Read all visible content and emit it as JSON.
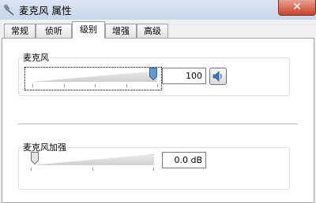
{
  "window": {
    "title": "麦克风 属性",
    "close_label": "✕"
  },
  "tabs": [
    "常规",
    "侦听",
    "级别",
    "增强",
    "高级"
  ],
  "active_tab": 2,
  "microphone": {
    "label": "麦克风",
    "value": "100",
    "level_percent": 100,
    "mute_icon": "speaker-icon"
  },
  "boost": {
    "label": "麦克风加强",
    "value": "0.0 dB",
    "level_percent": 0
  },
  "colors": {
    "titlebar": "#c7d6ea",
    "close_button": "#c8432b",
    "track": "#cfcfcf",
    "thumb_blue": "#5e9ad6"
  }
}
